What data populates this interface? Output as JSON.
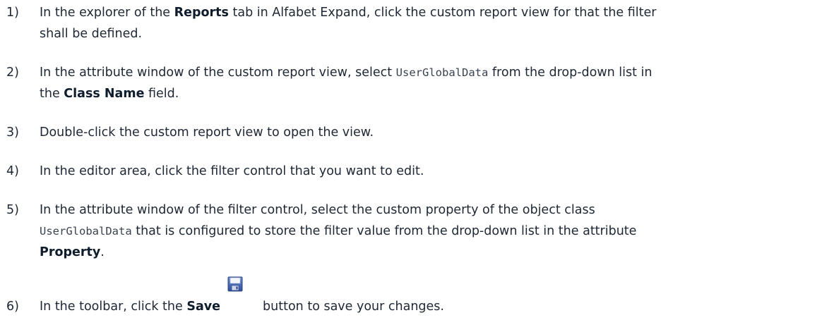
{
  "steps": [
    {
      "number": "1)",
      "line1": {
        "pre": "In the explorer of the ",
        "bold": "Reports",
        "post": " tab in Alfabet Expand, click the custom report view for that the filter"
      },
      "line2": "shall be defined."
    },
    {
      "number": "2)",
      "line1": {
        "pre": "In the attribute window of the custom report view, select ",
        "code": "UserGlobalData",
        "post": " from the drop-down list in"
      },
      "line2": {
        "pre": "the ",
        "bold": "Class Name",
        "post": " field."
      }
    },
    {
      "number": "3)",
      "text": "Double-click the custom report view to open the view."
    },
    {
      "number": "4)",
      "text": "In the editor area, click the filter control that you want to edit."
    },
    {
      "number": "5)",
      "line1": "In the attribute window of the filter control, select the custom property of the object class",
      "line2": {
        "code": "UserGlobalData",
        "post": " that is configured to store the filter value from the drop-down list in the attribute"
      },
      "line3": {
        "bold": "Property",
        "post": "."
      }
    },
    {
      "number": "6)",
      "pre": "In the toolbar, click the ",
      "bold": "Save",
      "icon": "save-floppy-icon",
      "post": "button to save your changes."
    }
  ]
}
